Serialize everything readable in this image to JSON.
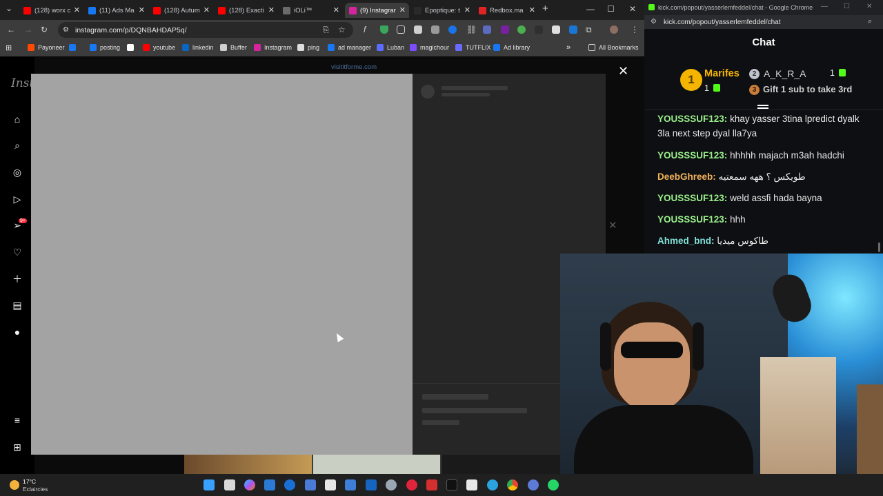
{
  "browser": {
    "tabs": [
      {
        "label": "(128) worx c",
        "icon": "youtube-icon",
        "color": "#ff0000",
        "active": false
      },
      {
        "label": "(11) Ads Ma",
        "icon": "meta-icon",
        "color": "#1877f2",
        "active": false
      },
      {
        "label": "(128) Autum",
        "icon": "youtube-icon",
        "color": "#ff0000",
        "active": false
      },
      {
        "label": "(128) Exacti",
        "icon": "youtube-icon",
        "color": "#ff0000",
        "active": false
      },
      {
        "label": "iOLi™",
        "icon": "ioli-icon",
        "color": "#6b6b6b",
        "active": false
      },
      {
        "label": "(9) Instagrar",
        "icon": "instagram-icon",
        "color": "#d6249f",
        "active": true
      },
      {
        "label": "Epoptique: t",
        "icon": "epoptique-icon",
        "color": "#2a2a2a",
        "active": false
      },
      {
        "label": "Redbox.ma",
        "icon": "redbox-icon",
        "color": "#e02424",
        "active": false
      }
    ],
    "url": "instagram.com/p/DQNBAHDAP5q/",
    "bookmarks": [
      {
        "label": "Payoneer",
        "color": "#ff4800"
      },
      {
        "label": "",
        "color": "#1877f2"
      },
      {
        "label": "posting",
        "color": "#1877f2"
      },
      {
        "label": "",
        "color": "#ffffff"
      },
      {
        "label": "youtube",
        "color": "#ff0000"
      },
      {
        "label": "linkedin",
        "color": "#0a66c2"
      },
      {
        "label": "Buffer",
        "color": "#cfcfcf"
      },
      {
        "label": "Instagram",
        "color": "#d6249f"
      },
      {
        "label": "ping",
        "color": "#dddddd"
      },
      {
        "label": "ad manager",
        "color": "#1877f2"
      },
      {
        "label": "Luban",
        "color": "#5b6cff"
      },
      {
        "label": "magichour",
        "color": "#7c4dff"
      },
      {
        "label": "TUTFLIX",
        "color": "#6a6aff"
      },
      {
        "label": "Ad library",
        "color": "#1877f2"
      }
    ],
    "all_bookmarks": "All Bookmarks"
  },
  "instagram": {
    "logo": "Inst",
    "overlay_link": "visititforme.com",
    "notification_badge": "9+"
  },
  "kick": {
    "window_title": "kick.com/popout/yasserlemfeddel/chat - Google Chrome",
    "url": "kick.com/popout/yasserlemfeddel/chat",
    "chat_title": "Chat",
    "leaderboard": {
      "first": {
        "rank": "1",
        "name": "Marifes",
        "count": "1"
      },
      "second": {
        "rank": "2",
        "name": "A_K_R_A",
        "count": "1"
      },
      "third": {
        "rank": "3",
        "text": "Gift 1 sub to take 3rd"
      }
    },
    "messages": [
      {
        "user": "YOUSSSUF123:",
        "text": "khay yasser 3tina lpredict dyalk 3la next step dyal lla7ya",
        "color": "#9bf08b"
      },
      {
        "user": "YOUSSSUF123:",
        "text": "hhhhh majach m3ah hadchi",
        "color": "#9bf08b"
      },
      {
        "user": "DeebGhreeb:",
        "text": "طويكس ؟ ههه سمعتيه",
        "color": "#f2b35c"
      },
      {
        "user": "YOUSSSUF123:",
        "text": "weld assfi hada bayna",
        "color": "#9bf08b"
      },
      {
        "user": "YOUSSSUF123:",
        "text": "hhh",
        "color": "#9bf08b"
      },
      {
        "user": "Ahmed_bnd:",
        "text": "طاكوس ميديا",
        "color": "#7fe0d9"
      }
    ]
  },
  "taskbar": {
    "weather_temp": "17°C",
    "weather_desc": "Eclaircies"
  }
}
